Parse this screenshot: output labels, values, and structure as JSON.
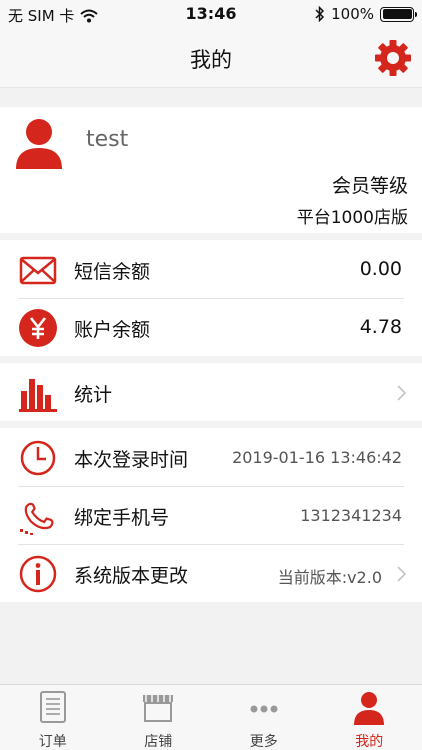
{
  "status_bar": {
    "carrier": "无 SIM 卡",
    "time": "13:46",
    "battery": "100%"
  },
  "nav": {
    "title": "我的"
  },
  "profile": {
    "username": "test",
    "level_label": "会员等级",
    "level_value": "平台1000店版"
  },
  "balances": [
    {
      "label": "短信余额",
      "value": "0.00",
      "icon": "envelope-icon"
    },
    {
      "label": "账户余额",
      "value": "4.78",
      "icon": "yen-icon"
    }
  ],
  "stats": {
    "label": "统计",
    "icon": "bar-chart-icon"
  },
  "info": [
    {
      "label": "本次登录时间",
      "value": "2019-01-16 13:46:42",
      "icon": "clock-icon"
    },
    {
      "label": "绑定手机号",
      "value": "1312341234",
      "icon": "phone-icon"
    },
    {
      "label": "系统版本更改",
      "value": "当前版本:v2.0",
      "icon": "info-icon"
    }
  ],
  "tabs": [
    {
      "label": "订单",
      "icon": "order-icon"
    },
    {
      "label": "店铺",
      "icon": "store-icon"
    },
    {
      "label": "更多",
      "icon": "more-icon"
    },
    {
      "label": "我的",
      "icon": "profile-icon",
      "active": true
    }
  ],
  "colors": {
    "accent": "#d4261c",
    "background": "#f2f2f2"
  }
}
